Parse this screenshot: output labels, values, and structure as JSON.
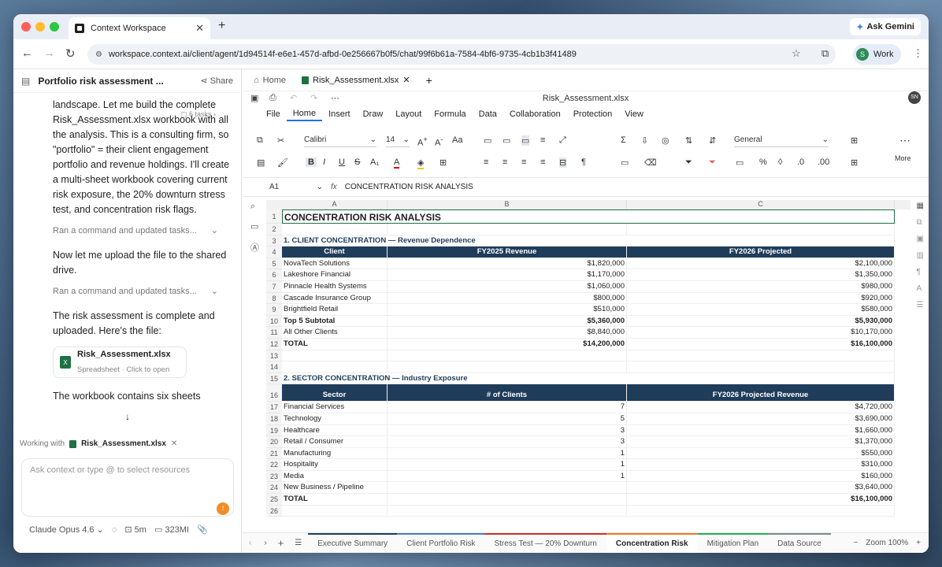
{
  "browser": {
    "tab_title": "Context Workspace",
    "url": "workspace.context.ai/client/agent/1d94514f-e6e1-457d-afbd-0e256667b0f5/chat/99f6b61a-7584-4bf6-9735-4cb1b3f41489",
    "ask_gemini": "Ask Gemini",
    "profile_label": "Work",
    "profile_initial": "S"
  },
  "chat": {
    "title": "Portfolio risk assessment ...",
    "share_label": "Share",
    "tasks_badge": "6 tasks",
    "para1": "landscape. Let me build the complete Risk_Assessment.xlsx workbook with all the analysis. This is a consulting firm, so \"portfolio\" = their client engagement portfolio and revenue holdings. I'll create a multi-sheet workbook covering current risk exposure, the 20% downturn stress test, and concentration risk flags.",
    "step1": "Ran a command and updated tasks...",
    "para2": "Now let me upload the file to the shared drive.",
    "step2": "Ran a command and updated tasks...",
    "para3": "The risk assessment is complete and uploaded. Here's the file:",
    "file_name": "Risk_Assessment.xlsx",
    "file_sub": "Spreadsheet · Click to open",
    "para4": "The workbook contains six sheets",
    "working_with_label": "Working with",
    "working_with_file": "Risk_Assessment.xlsx",
    "input_placeholder": "Ask context or type @ to select resources",
    "model": "Claude Opus 4.6",
    "elapsed": "5m",
    "memory": "323MI"
  },
  "sheet": {
    "home_tab": "Home",
    "file_tab": "Risk_Assessment.xlsx",
    "doc_name": "Risk_Assessment.xlsx",
    "user_initials": "SN",
    "menus": [
      "File",
      "Home",
      "Insert",
      "Draw",
      "Layout",
      "Formula",
      "Data",
      "Collaboration",
      "Protection",
      "View"
    ],
    "font": "Calibri",
    "font_size": "14",
    "number_format": "General",
    "more_label": "More",
    "cell_ref": "A1",
    "formula": "CONCENTRATION RISK ANALYSIS",
    "columns": [
      "A",
      "B",
      "C"
    ],
    "rows": [
      {
        "n": "1",
        "a": "CONCENTRATION RISK ANALYSIS",
        "b": "",
        "c": "",
        "kind": "title"
      },
      {
        "n": "2",
        "a": "",
        "b": "",
        "c": "",
        "kind": "blank"
      },
      {
        "n": "3",
        "a": "1. CLIENT CONCENTRATION — Revenue Dependence",
        "b": "",
        "c": "",
        "kind": "section"
      },
      {
        "n": "4",
        "a": "Client",
        "b": "FY2025 Revenue",
        "c": "FY2026 Projected",
        "kind": "header"
      },
      {
        "n": "5",
        "a": "NovaTech Solutions",
        "b": "$1,820,000",
        "c": "$2,100,000",
        "kind": "data"
      },
      {
        "n": "6",
        "a": "Lakeshore Financial",
        "b": "$1,170,000",
        "c": "$1,350,000",
        "kind": "data"
      },
      {
        "n": "7",
        "a": "Pinnacle Health Systems",
        "b": "$1,060,000",
        "c": "$980,000",
        "kind": "data"
      },
      {
        "n": "8",
        "a": "Cascade Insurance Group",
        "b": "$800,000",
        "c": "$920,000",
        "kind": "data"
      },
      {
        "n": "9",
        "a": "Brightfield Retail",
        "b": "$510,000",
        "c": "$580,000",
        "kind": "data"
      },
      {
        "n": "10",
        "a": "Top 5 Subtotal",
        "b": "$5,360,000",
        "c": "$5,930,000",
        "kind": "bold"
      },
      {
        "n": "11",
        "a": "All Other Clients",
        "b": "$8,840,000",
        "c": "$10,170,000",
        "kind": "data"
      },
      {
        "n": "12",
        "a": "TOTAL",
        "b": "$14,200,000",
        "c": "$16,100,000",
        "kind": "bold"
      },
      {
        "n": "13",
        "a": "",
        "b": "",
        "c": "",
        "kind": "blank"
      },
      {
        "n": "14",
        "a": "",
        "b": "",
        "c": "",
        "kind": "blank"
      },
      {
        "n": "15",
        "a": "2. SECTOR CONCENTRATION — Industry Exposure",
        "b": "",
        "c": "",
        "kind": "section"
      },
      {
        "n": "16",
        "a": "Sector",
        "b": "# of Clients",
        "c": "FY2026 Projected Revenue",
        "kind": "header"
      },
      {
        "n": "17",
        "a": "Financial Services",
        "b": "7",
        "c": "$4,720,000",
        "kind": "data"
      },
      {
        "n": "18",
        "a": "Technology",
        "b": "5",
        "c": "$3,690,000",
        "kind": "data"
      },
      {
        "n": "19",
        "a": "Healthcare",
        "b": "3",
        "c": "$1,660,000",
        "kind": "data"
      },
      {
        "n": "20",
        "a": "Retail / Consumer",
        "b": "3",
        "c": "$1,370,000",
        "kind": "data"
      },
      {
        "n": "21",
        "a": "Manufacturing",
        "b": "1",
        "c": "$550,000",
        "kind": "data"
      },
      {
        "n": "22",
        "a": "Hospitality",
        "b": "1",
        "c": "$310,000",
        "kind": "data"
      },
      {
        "n": "23",
        "a": "Media",
        "b": "1",
        "c": "$160,000",
        "kind": "data"
      },
      {
        "n": "24",
        "a": "New Business / Pipeline",
        "b": "",
        "c": "$3,640,000",
        "kind": "data"
      },
      {
        "n": "25",
        "a": "TOTAL",
        "b": "",
        "c": "$16,100,000",
        "kind": "bold"
      },
      {
        "n": "26",
        "a": "",
        "b": "",
        "c": "",
        "kind": "blank"
      }
    ],
    "sheet_tabs": [
      {
        "label": "Executive Summary",
        "color": "#1f3c5a"
      },
      {
        "label": "Client Portfolio Risk",
        "color": "#4a7fc1"
      },
      {
        "label": "Stress Test — 20% Downturn",
        "color": "#c0392b"
      },
      {
        "label": "Concentration Risk",
        "color": "#e67e22"
      },
      {
        "label": "Mitigation Plan",
        "color": "#27ae60"
      },
      {
        "label": "Data Source",
        "color": "#7f8c8d"
      }
    ],
    "active_sheet": "Concentration Risk",
    "zoom_label": "Zoom 100%"
  }
}
